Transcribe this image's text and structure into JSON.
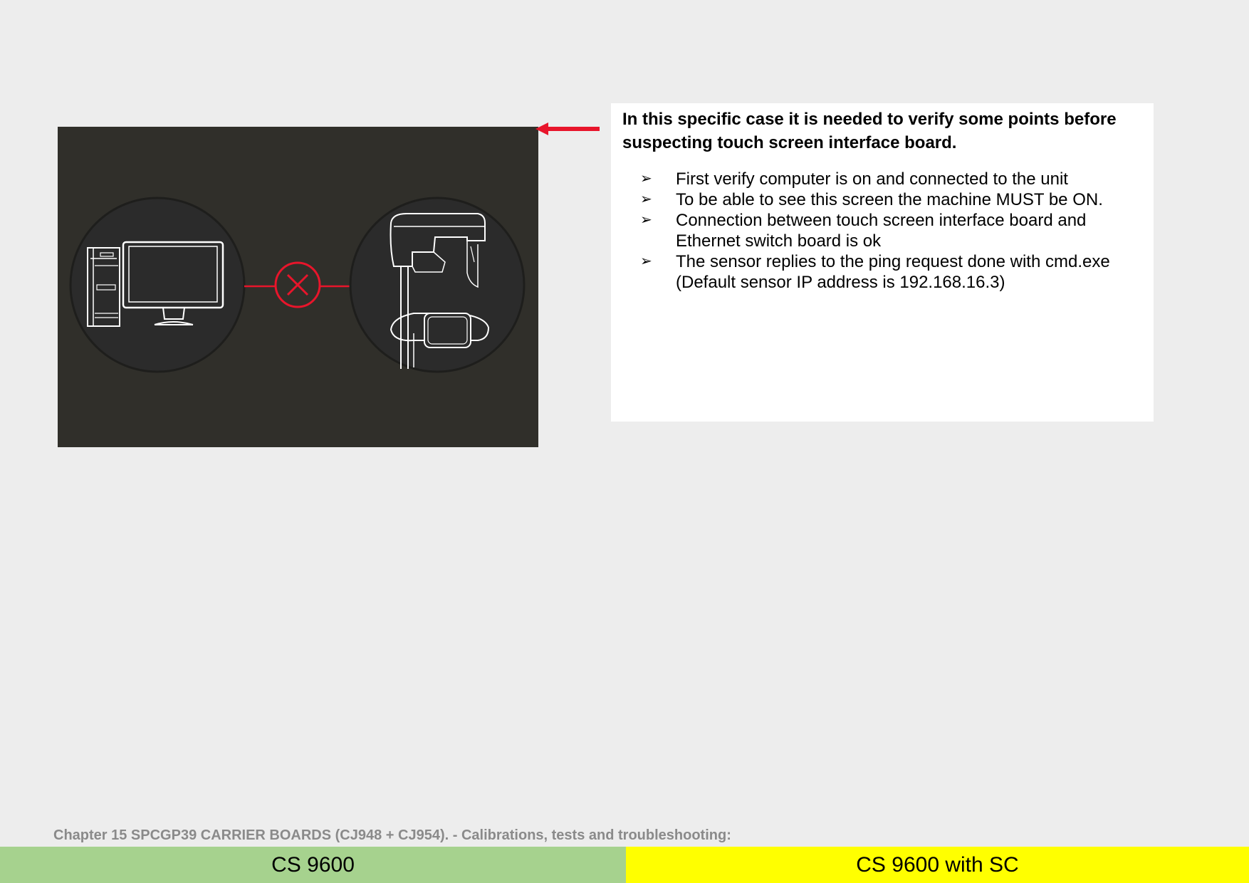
{
  "colors": {
    "page_bg": "#ededed",
    "screenshot_bg": "#302f2a",
    "accent_red": "#e8152b",
    "tab_left_bg": "#a6d28e",
    "tab_right_bg": "#ffff00",
    "chapter_text": "#8a8a8a"
  },
  "textbox": {
    "heading": "In this specific case it is needed to verify some points before suspecting touch screen interface board.",
    "bullets": [
      {
        "text": "First verify computer is on and connected to the unit"
      },
      {
        "text": "To be able to see this screen the machine MUST be ON."
      },
      {
        "text": "Connection between touch screen interface board and Ethernet switch board is ok"
      },
      {
        "text": "The sensor replies to the ping request done with cmd.exe (Default sensor IP address is 192.168.16.3)"
      }
    ],
    "bullet_glyph": "➢"
  },
  "screenshot": {
    "icons": [
      "computer-icon",
      "disconnected-icon",
      "xray-unit-icon"
    ]
  },
  "footer": {
    "chapter": "Chapter 15 SPCGP39 CARRIER BOARDS (CJ948 + CJ954). - Calibrations, tests and troubleshooting:",
    "tab_left": "CS 9600",
    "tab_right": "CS 9600 with SC"
  }
}
